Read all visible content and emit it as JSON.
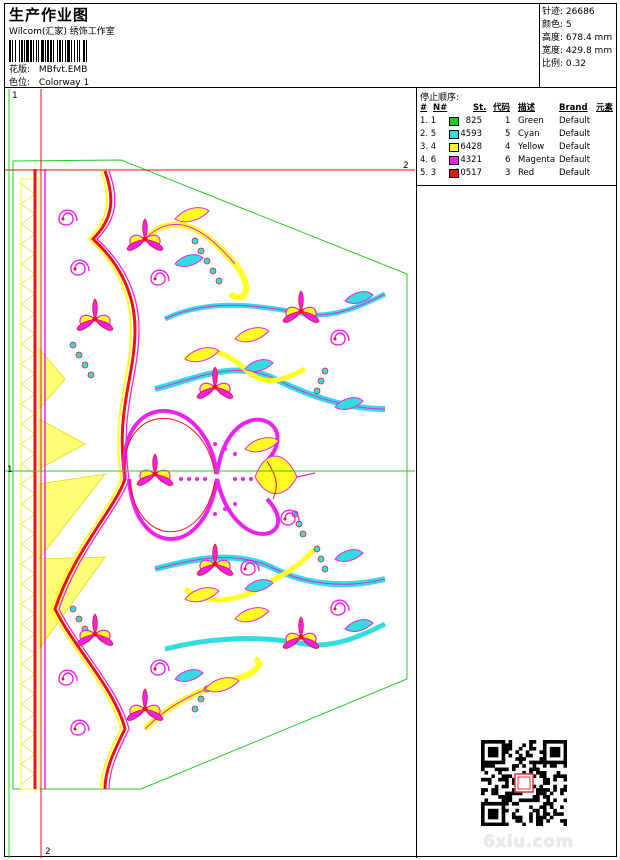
{
  "header": {
    "title": "生产作业图",
    "subtitle": "Wilcom(汇家) 绣饰工作室",
    "design_label": "花版:",
    "design_value": "MBfvt.EMB",
    "colorway_label": "色位:",
    "colorway_value": "Colorway 1"
  },
  "info": {
    "stitches_label": "针迹:",
    "stitches_value": "26686",
    "colors_label": "颜色:",
    "colors_value": "5",
    "height_label": "高度:",
    "height_value": "678.4 mm",
    "width_label": "宽度:",
    "width_value": "429.8 mm",
    "scale_label": "比例:",
    "scale_value": "0.32"
  },
  "stop_sequence": {
    "title": "停止顺序:",
    "headers": {
      "hash": "#",
      "n": "N#",
      "st": "St.",
      "code": "代码",
      "desc": "描述",
      "brand": "Brand",
      "element": "元素"
    },
    "rows": [
      {
        "idx": "1. 1",
        "color": "#22cc22",
        "st": "825",
        "code": "1",
        "desc": "Green",
        "brand": "Default"
      },
      {
        "idx": "2. 5",
        "color": "#33dddd",
        "st": "4593",
        "code": "5",
        "desc": "Cyan",
        "brand": "Default"
      },
      {
        "idx": "3. 4",
        "color": "#ffff22",
        "st": "6428",
        "code": "4",
        "desc": "Yellow",
        "brand": "Default"
      },
      {
        "idx": "4. 6",
        "color": "#ee22ee",
        "st": "4321",
        "code": "6",
        "desc": "Magenta",
        "brand": "Default"
      },
      {
        "idx": "5. 3",
        "color": "#ee1111",
        "st": "10517",
        "code": "3",
        "desc": "Red",
        "brand": "Default"
      }
    ]
  },
  "rulers": {
    "top_left": "1",
    "right_marker": "2",
    "left_center": "1",
    "bottom_marker": "2"
  },
  "watermark": "6xiu.com",
  "colors": {
    "green": "#22cc22",
    "cyan": "#33dddd",
    "yellow": "#ffff22",
    "magenta": "#ee22ee",
    "red": "#ee1111"
  }
}
